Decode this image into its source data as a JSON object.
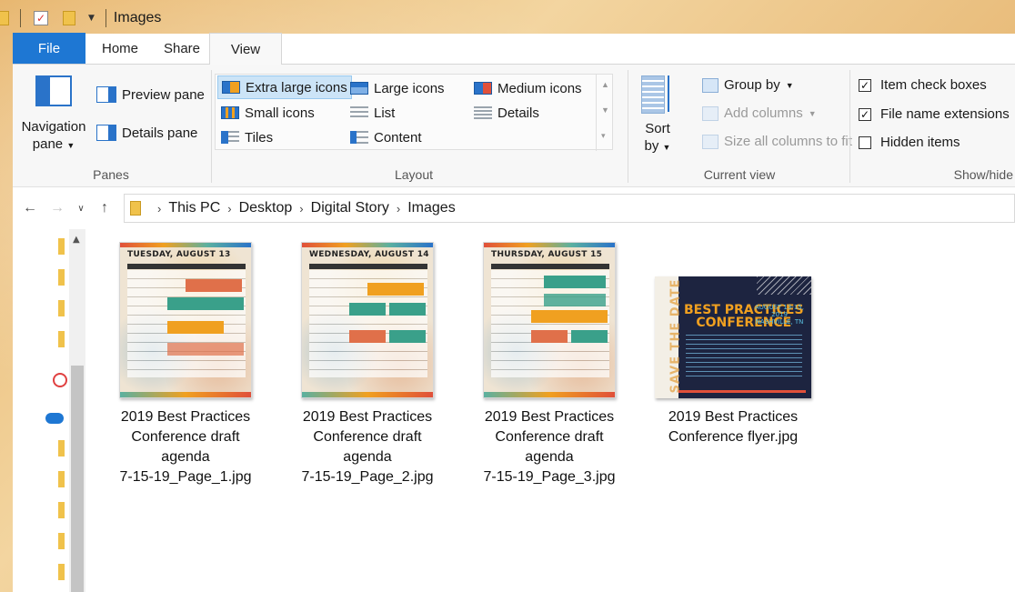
{
  "window": {
    "title": "Images"
  },
  "tabs": [
    {
      "label": "File"
    },
    {
      "label": "Home"
    },
    {
      "label": "Share"
    },
    {
      "label": "View"
    }
  ],
  "ribbon": {
    "panes": {
      "navigation_pane_line1": "Navigation",
      "navigation_pane_line2": "pane",
      "preview_pane": "Preview pane",
      "details_pane": "Details pane",
      "group_label": "Panes"
    },
    "layout": {
      "items": [
        {
          "label": "Extra large icons",
          "selected": true
        },
        {
          "label": "Large icons"
        },
        {
          "label": "Medium icons"
        },
        {
          "label": "Small icons"
        },
        {
          "label": "List"
        },
        {
          "label": "Details"
        },
        {
          "label": "Tiles"
        },
        {
          "label": "Content"
        }
      ],
      "group_label": "Layout"
    },
    "current_view": {
      "sort_line1": "Sort",
      "sort_line2": "by",
      "group_by": "Group by",
      "add_columns": "Add columns",
      "size_columns": "Size all columns to fit",
      "group_label": "Current view"
    },
    "show_hide": {
      "item_check_boxes": {
        "label": "Item check boxes",
        "checked": true
      },
      "file_name_extensions": {
        "label": "File name extensions",
        "checked": true
      },
      "hidden_items": {
        "label": "Hidden items",
        "checked": false
      },
      "group_label": "Show/hide"
    }
  },
  "address": {
    "crumbs": [
      "This PC",
      "Desktop",
      "Digital Story",
      "Images"
    ]
  },
  "files": [
    {
      "line1": "2019 Best Practices",
      "line2": "Conference draft",
      "line3": "agenda",
      "line4": "7-15-19_Page_1.jpg",
      "thumb_title": "TUESDAY, AUGUST 13"
    },
    {
      "line1": "2019 Best Practices",
      "line2": "Conference draft",
      "line3": "agenda",
      "line4": "7-15-19_Page_2.jpg",
      "thumb_title": "WEDNESDAY, AUGUST 14"
    },
    {
      "line1": "2019 Best Practices",
      "line2": "Conference draft",
      "line3": "agenda",
      "line4": "7-15-19_Page_3.jpg",
      "thumb_title": "THURSDAY, AUGUST 15"
    },
    {
      "line1": "2019 Best Practices",
      "line2": "Conference flyer.jpg",
      "flyer_title1": "BEST PRACTICES",
      "flyer_title2": "CONFERENCE",
      "flyer_dates": "AUGUST 13-15, 2019",
      "flyer_place": "NASHVILLE, TN",
      "flyer_side": "SAVE THE DATE"
    }
  ],
  "icons": {
    "quick_access_folder": "folder-icon",
    "properties": "check-icon",
    "back": "arrow-left-icon",
    "forward": "arrow-right-icon",
    "recent": "chevron-down-icon",
    "up": "arrow-up-icon",
    "onedrive": "cloud-icon"
  },
  "colors": {
    "file_tab": "#1e77d3",
    "selected_layout": "#cce4f7",
    "folder": "#f0c24b"
  }
}
